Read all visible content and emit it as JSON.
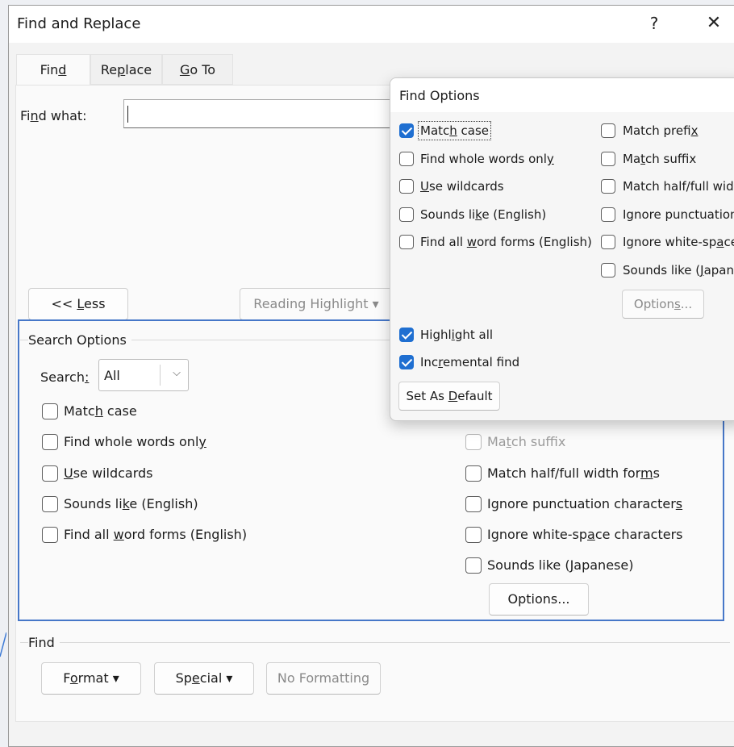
{
  "window": {
    "title": "Find and Replace",
    "help_glyph": "?",
    "close_glyph": "✕"
  },
  "tabs": [
    {
      "pre": "Fin",
      "key": "d",
      "post": ""
    },
    {
      "pre": "Re",
      "key": "p",
      "post": "lace"
    },
    {
      "pre": "",
      "key": "G",
      "post": "o To"
    }
  ],
  "find_what": {
    "pre": "Fi",
    "key": "n",
    "post": "d what:",
    "value": ""
  },
  "buttons": {
    "less": {
      "pre": "<< ",
      "key": "L",
      "post": "ess"
    },
    "reading_highlight": "Reading Highlight ▾",
    "format": {
      "pre": "F",
      "key": "o",
      "post": "rmat ▾"
    },
    "special": {
      "pre": "Sp",
      "key": "e",
      "post": "cial ▾"
    },
    "no_formatting": "No Formatting",
    "options": "Options..."
  },
  "search_options": {
    "group_label": "Search Options",
    "search_label": {
      "pre": "Search",
      "key": ":",
      "post": ""
    },
    "search_value": "All",
    "left_checks": [
      {
        "pre": "Matc",
        "key": "h",
        "post": " case",
        "checked": false
      },
      {
        "pre": "Find whole words onl",
        "key": "y",
        "post": "",
        "checked": false
      },
      {
        "pre": "",
        "key": "U",
        "post": "se wildcards",
        "checked": false
      },
      {
        "pre": "Sounds li",
        "key": "k",
        "post": "e (English)",
        "checked": false
      },
      {
        "pre": "Find all ",
        "key": "w",
        "post": "ord forms (English)",
        "checked": false
      }
    ],
    "right_checks": [
      {
        "pre": "Ma",
        "key": "t",
        "post": "ch suffix",
        "checked": false,
        "disabled": true
      },
      {
        "pre": "Match half/full width for",
        "key": "m",
        "post": "s",
        "checked": false,
        "disabled": false
      },
      {
        "pre": "Ignore punctuation character",
        "key": "s",
        "post": "",
        "checked": false,
        "disabled": false
      },
      {
        "pre": "Ignore white-sp",
        "key": "a",
        "post": "ce characters",
        "checked": false,
        "disabled": false
      },
      {
        "pre": "Sounds like (",
        "key": "J",
        "post": "apanese)",
        "checked": false,
        "disabled": false
      }
    ]
  },
  "find_group": {
    "label": "Find"
  },
  "popup": {
    "title": "Find Options",
    "left_checks": [
      {
        "pre": "Matc",
        "key": "h",
        "post": " case",
        "checked": true
      },
      {
        "pre": "Find whole words onl",
        "key": "y",
        "post": "",
        "checked": false
      },
      {
        "pre": "",
        "key": "U",
        "post": "se wildcards",
        "checked": false
      },
      {
        "pre": "Sounds li",
        "key": "k",
        "post": "e (English)",
        "checked": false
      },
      {
        "pre": "Find all ",
        "key": "w",
        "post": "ord forms (English)",
        "checked": false
      }
    ],
    "right_checks": [
      {
        "pre": "Match prefi",
        "key": "x",
        "post": "",
        "checked": false
      },
      {
        "pre": "Ma",
        "key": "t",
        "post": "ch suffix",
        "checked": false
      },
      {
        "pre": "Match half/full widtl",
        "key": "",
        "post": "",
        "checked": false
      },
      {
        "pre": "Ignore punctuation",
        "key": "",
        "post": "",
        "checked": false
      },
      {
        "pre": "Ignore white-sp",
        "key": "a",
        "post": "ce c",
        "checked": false
      },
      {
        "pre": "Sounds like (",
        "key": "J",
        "post": "apanes",
        "checked": false
      }
    ],
    "options_button": {
      "pre": "Option",
      "key": "s",
      "post": "..."
    },
    "highlight_all": {
      "pre": "Highl",
      "key": "i",
      "post": "ght all",
      "checked": true
    },
    "incremental_find": {
      "pre": "Inc",
      "key": "r",
      "post": "emental find",
      "checked": true
    },
    "set_default": {
      "pre": "Set As ",
      "key": "D",
      "post": "efault"
    }
  },
  "colors": {
    "accent": "#1f6fd1",
    "selection_frame": "#4677c8"
  }
}
